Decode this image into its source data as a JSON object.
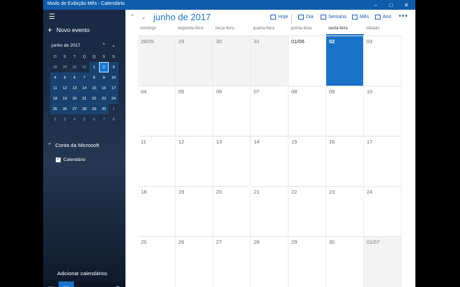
{
  "window": {
    "title": "Modo de Exibição Mês - Calendário"
  },
  "sidebar": {
    "new_event": "Novo evento",
    "mini_calendar": {
      "month": "junho de 2017",
      "weekdays": [
        "D",
        "S",
        "T",
        "Q",
        "Q",
        "S",
        "S"
      ],
      "weeks": [
        [
          "28",
          "29",
          "30",
          "31",
          "1",
          "2",
          "3"
        ],
        [
          "4",
          "5",
          "6",
          "7",
          "8",
          "9",
          "10"
        ],
        [
          "11",
          "12",
          "13",
          "14",
          "15",
          "16",
          "17"
        ],
        [
          "18",
          "19",
          "20",
          "21",
          "22",
          "23",
          "24"
        ],
        [
          "25",
          "26",
          "27",
          "28",
          "29",
          "30",
          "1"
        ],
        [
          "2",
          "3",
          "4",
          "5",
          "6",
          "7",
          "8"
        ]
      ]
    },
    "account": "Conta da Microsoft",
    "calendar_item": "Calendário",
    "add_calendars": "Adicionar calendários"
  },
  "toolbar": {
    "month_title": "junho de 2017",
    "today": "Hoje",
    "day": "Dia",
    "week": "Semana",
    "month": "Mês",
    "year": "Ano",
    "more": "•••"
  },
  "month_grid": {
    "weekdays": [
      "domingo",
      "segunda-feira",
      "terça-feira",
      "quarta-feira",
      "quinta-feira",
      "sexta-feira",
      "sábado"
    ],
    "weeks": [
      [
        "28/05",
        "29",
        "30",
        "31",
        "01/06",
        "02",
        "03"
      ],
      [
        "04",
        "05",
        "06",
        "07",
        "08",
        "09",
        "10"
      ],
      [
        "11",
        "12",
        "13",
        "14",
        "15",
        "16",
        "17"
      ],
      [
        "18",
        "19",
        "20",
        "21",
        "22",
        "23",
        "24"
      ],
      [
        "25",
        "26",
        "27",
        "28",
        "29",
        "30",
        "01/07"
      ]
    ]
  }
}
